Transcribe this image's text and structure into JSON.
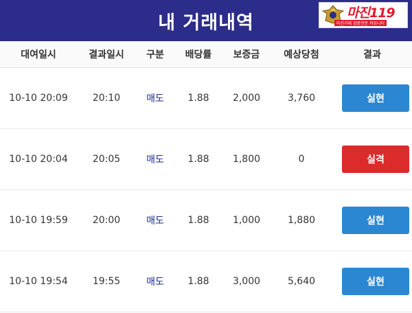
{
  "header": {
    "title": "내 거래내역"
  },
  "logo": {
    "text": "마진119",
    "sub": "마진거래 검증전문 커뮤니티"
  },
  "columns": [
    "대여일시",
    "결과일시",
    "구분",
    "배당률",
    "보증금",
    "예상당첨",
    "결과"
  ],
  "colors": {
    "header_bg": "#2c2c8a",
    "win": "#2b87d1",
    "lose": "#dc2b2b",
    "type_text": "#1e2b8c"
  },
  "rows": [
    {
      "start": "10-10 20:09",
      "end": "20:10",
      "type": "매도",
      "odds": "1.88",
      "deposit": "2,000",
      "expected": "3,760",
      "result": "실현",
      "status": "win"
    },
    {
      "start": "10-10 20:04",
      "end": "20:05",
      "type": "매도",
      "odds": "1.88",
      "deposit": "1,800",
      "expected": "0",
      "result": "실격",
      "status": "lose"
    },
    {
      "start": "10-10 19:59",
      "end": "20:00",
      "type": "매도",
      "odds": "1.88",
      "deposit": "1,000",
      "expected": "1,880",
      "result": "실현",
      "status": "win"
    },
    {
      "start": "10-10 19:54",
      "end": "19:55",
      "type": "매도",
      "odds": "1.88",
      "deposit": "3,000",
      "expected": "5,640",
      "result": "실현",
      "status": "win"
    }
  ]
}
